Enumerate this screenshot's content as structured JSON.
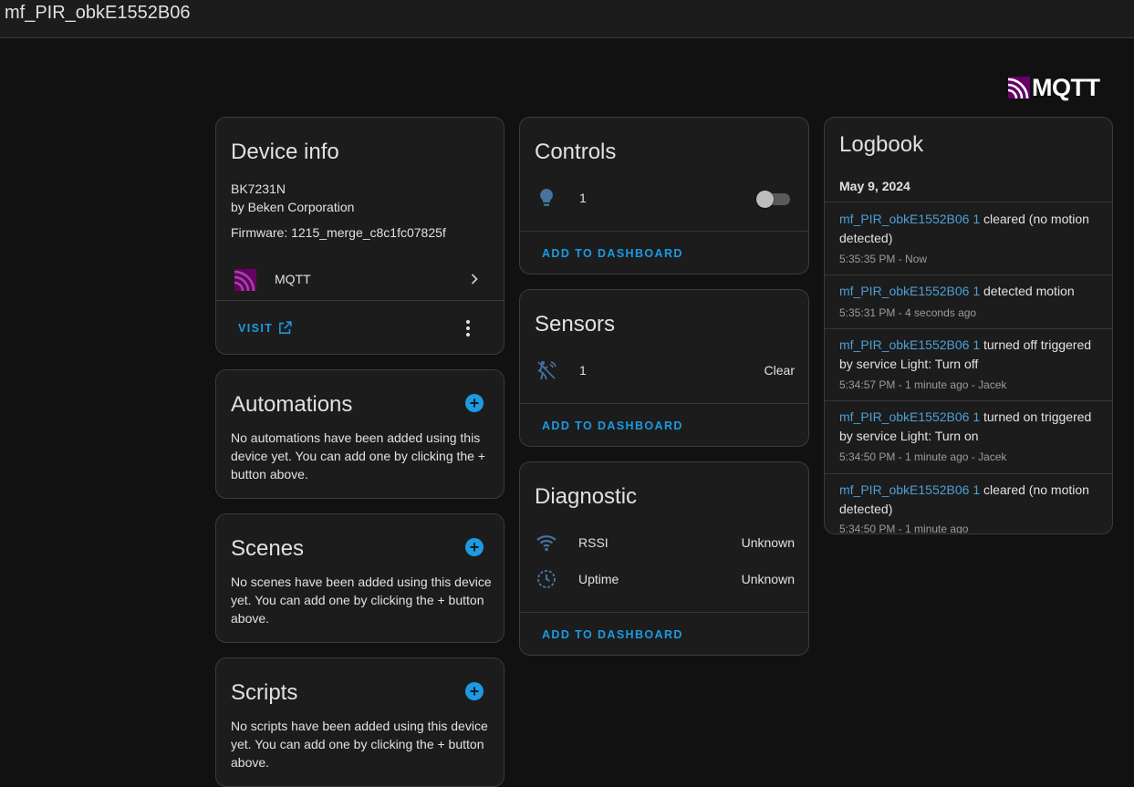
{
  "header": {
    "title": "mf_PIR_obkE1552B06"
  },
  "logo": {
    "word": "MQTT"
  },
  "device_info": {
    "title": "Device info",
    "model": "BK7231N",
    "manufacturer": "by Beken Corporation",
    "firmware": "Firmware: 1215_merge_c8c1fc07825f",
    "integration_label": "MQTT",
    "visit_label": "VISIT"
  },
  "automations": {
    "title": "Automations",
    "text": "No automations have been added using this device yet. You can add one by clicking the + button above."
  },
  "scenes": {
    "title": "Scenes",
    "text": "No scenes have been added using this device yet. You can add one by clicking the + button above."
  },
  "scripts": {
    "title": "Scripts",
    "text": "No scripts have been added using this device yet. You can add one by clicking the + button above."
  },
  "controls": {
    "title": "Controls",
    "entity_name": "1",
    "toggle_on": false,
    "add_label": "ADD TO DASHBOARD"
  },
  "sensors": {
    "title": "Sensors",
    "entity_name": "1",
    "entity_state": "Clear",
    "add_label": "ADD TO DASHBOARD"
  },
  "diagnostic": {
    "title": "Diagnostic",
    "rows": [
      {
        "label": "RSSI",
        "value": "Unknown",
        "icon": "wifi-icon"
      },
      {
        "label": "Uptime",
        "value": "Unknown",
        "icon": "clock-icon"
      }
    ],
    "add_label": "ADD TO DASHBOARD"
  },
  "logbook": {
    "title": "Logbook",
    "date": "May 9, 2024",
    "entries": [
      {
        "entity": "mf_PIR_obkE1552B06 1",
        "message": "cleared (no motion detected)",
        "time": "5:35:35 PM - Now"
      },
      {
        "entity": "mf_PIR_obkE1552B06 1",
        "message": "detected motion",
        "time": "5:35:31 PM - 4 seconds ago"
      },
      {
        "entity": "mf_PIR_obkE1552B06 1",
        "message": "turned off triggered by service Light: Turn off",
        "time": "5:34:57 PM - 1 minute ago - Jacek"
      },
      {
        "entity": "mf_PIR_obkE1552B06 1",
        "message": "turned on triggered by service Light: Turn on",
        "time": "5:34:50 PM - 1 minute ago - Jacek"
      },
      {
        "entity": "mf_PIR_obkE1552B06 1",
        "message": "cleared (no motion detected)",
        "time": "5:34:50 PM - 1 minute ago"
      }
    ]
  },
  "colors": {
    "accent": "#1a9be3",
    "link": "#4d9fd6",
    "mqtt_purple": "#660066"
  }
}
